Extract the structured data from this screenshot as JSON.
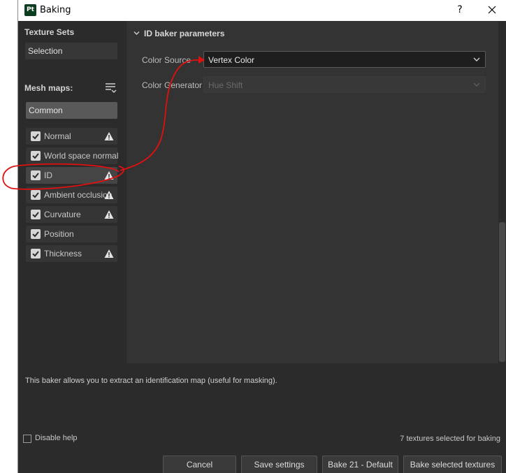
{
  "window": {
    "app_icon_text": "Pt",
    "title": "Baking",
    "help_glyph": "?"
  },
  "sidebar": {
    "texture_sets_heading": "Texture Sets",
    "selection_label": "Selection",
    "mesh_maps_heading": "Mesh maps:",
    "common_label": "Common",
    "maps": [
      {
        "label": "Normal",
        "checked": true,
        "warning": true
      },
      {
        "label": "World space normal",
        "checked": true,
        "warning": false
      },
      {
        "label": "ID",
        "checked": true,
        "warning": true,
        "active": true
      },
      {
        "label": "Ambient occlusion",
        "checked": true,
        "warning": true
      },
      {
        "label": "Curvature",
        "checked": true,
        "warning": true
      },
      {
        "label": "Position",
        "checked": true,
        "warning": false
      },
      {
        "label": "Thickness",
        "checked": true,
        "warning": true
      }
    ]
  },
  "main": {
    "section_title": "ID baker parameters",
    "params": [
      {
        "label": "Color Source",
        "value": "Vertex Color",
        "enabled": true
      },
      {
        "label": "Color Generator",
        "value": "Hue Shift",
        "enabled": false
      }
    ]
  },
  "footer": {
    "help_text": "This baker allows you to extract an identification map (useful for masking).",
    "disable_help_label": "Disable help",
    "disable_help_checked": false,
    "status_text": "7 textures selected for baking",
    "buttons": {
      "cancel": "Cancel",
      "save_settings": "Save settings",
      "bake_default": "Bake 21 - Default",
      "bake_selected": "Bake selected textures"
    }
  },
  "colors": {
    "annotation_red": "#e01010",
    "panel_bg": "#333333",
    "sidebar_bg": "#2b2b2b"
  }
}
